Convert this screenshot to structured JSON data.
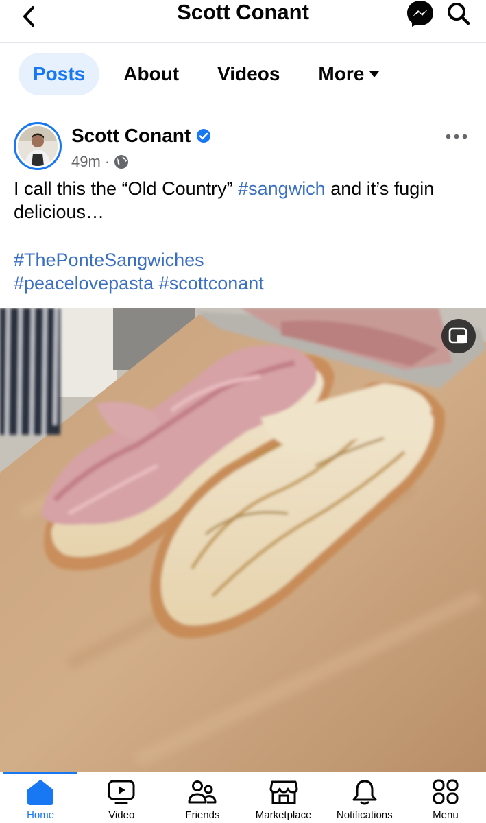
{
  "header": {
    "title": "Scott Conant",
    "back_icon": "chevron-left-icon",
    "messenger_icon": "messenger-icon",
    "search_icon": "search-icon"
  },
  "tabs": [
    {
      "label": "Posts",
      "active": true
    },
    {
      "label": "About",
      "active": false
    },
    {
      "label": "Videos",
      "active": false
    },
    {
      "label": "More",
      "active": false
    }
  ],
  "post": {
    "author": "Scott Conant",
    "verified": true,
    "time": "49m",
    "separator": "·",
    "privacy_icon": "globe-icon",
    "text_before": "I call this the “Old Country” ",
    "text_tag": "#sangwich",
    "text_after": " and it’s fugin delicious…",
    "hashtags": [
      "#ThePonteSangwiches",
      "#peacelovepasta",
      "#scottconant"
    ]
  },
  "bottom_nav": [
    {
      "label": "Home",
      "icon": "home-icon",
      "active": true
    },
    {
      "label": "Video",
      "icon": "video-icon",
      "active": false
    },
    {
      "label": "Friends",
      "icon": "friends-icon",
      "active": false
    },
    {
      "label": "Marketplace",
      "icon": "marketplace-icon",
      "active": false
    },
    {
      "label": "Notifications",
      "icon": "bell-icon",
      "active": false
    },
    {
      "label": "Menu",
      "icon": "menu-grid-icon",
      "active": false
    }
  ],
  "colors": {
    "accent": "#1877f2",
    "link": "#3a6fc4",
    "tab_active_bg": "#e7f0fd",
    "muted": "#65676b"
  }
}
